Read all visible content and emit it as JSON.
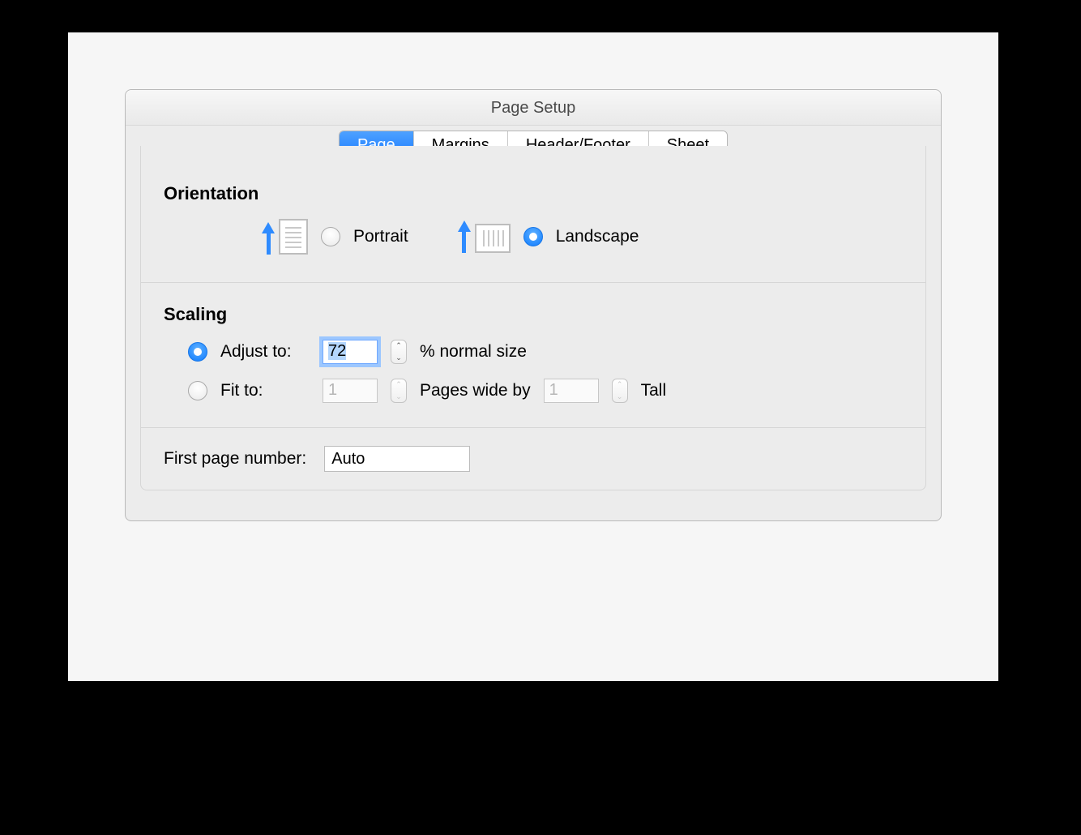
{
  "window": {
    "title": "Page Setup"
  },
  "tabs": {
    "page": "Page",
    "margins": "Margins",
    "header_footer": "Header/Footer",
    "sheet": "Sheet",
    "active": "page"
  },
  "orientation": {
    "heading": "Orientation",
    "portrait_label": "Portrait",
    "landscape_label": "Landscape",
    "selected": "landscape"
  },
  "scaling": {
    "heading": "Scaling",
    "adjust_label": "Adjust to:",
    "adjust_value": "72",
    "adjust_suffix": "% normal size",
    "fit_label": "Fit to:",
    "fit_wide": "1",
    "fit_mid": "Pages wide by",
    "fit_tall": "1",
    "fit_tall_label": "Tall",
    "mode": "adjust"
  },
  "first_page": {
    "label": "First page number:",
    "value": "Auto"
  }
}
